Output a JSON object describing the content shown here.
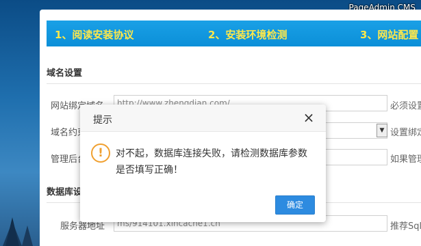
{
  "brand": "PageAdmin CMS",
  "steps": [
    "1、阅读安装协议",
    "2、安装环境检测",
    "3、网站配置"
  ],
  "sections": {
    "domain": "域名设置",
    "database": "数据库设"
  },
  "rows": [
    {
      "label": "网站绑定域名",
      "value": "http://www.zhengdian.com/",
      "hint": "必须设置"
    },
    {
      "label": "域名约束",
      "value": "",
      "hint": "设置绑定"
    },
    {
      "label": "管理后台",
      "value": "",
      "hint": "如果管理"
    }
  ],
  "db_rows": [
    {
      "label": "服务器地址",
      "value": "ms/914101.xincache1.cn",
      "hint": "推荐Sql"
    }
  ],
  "dialog": {
    "title": "提示",
    "close": "×",
    "icon": "!",
    "message": "对不起，数据库连接失败，请检测数据库参数是否填写正确！",
    "ok": "确定"
  },
  "colors": {
    "accent": "#2d8be0",
    "step_bar": "#0b8fd8",
    "step_text": "#ffe84a",
    "warn": "#f0a030"
  }
}
